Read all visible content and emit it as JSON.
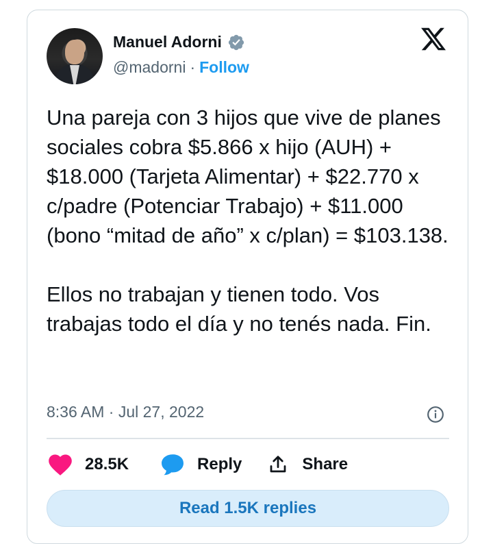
{
  "author": {
    "name": "Manuel Adorni",
    "handle": "@madorni",
    "separator": "·",
    "follow_label": "Follow",
    "verified_icon": "verified-badge-icon"
  },
  "brand": {
    "logo_icon": "x-logo-icon"
  },
  "tweet": {
    "paragraphs": [
      "Una pareja con 3 hijos que vive de planes sociales cobra $5.866 x hijo (AUH) + $18.000 (Tarjeta Alimentar) + $22.770 x c/padre (Potenciar Trabajo) + $11.000 (bono “mitad de año” x c/plan) = $103.138.",
      "Ellos no trabajan y tienen todo. Vos trabajas todo el día y no tenés nada. Fin."
    ],
    "timestamp": "8:36 AM · Jul 27, 2022"
  },
  "actions": {
    "likes_count": "28.5K",
    "reply_label": "Reply",
    "share_label": "Share",
    "read_replies_label": "Read 1.5K replies"
  },
  "colors": {
    "accent": "#1d9bf0",
    "like": "#f91880",
    "text": "#0f1419",
    "muted": "#536471",
    "verified": "#829aab"
  }
}
